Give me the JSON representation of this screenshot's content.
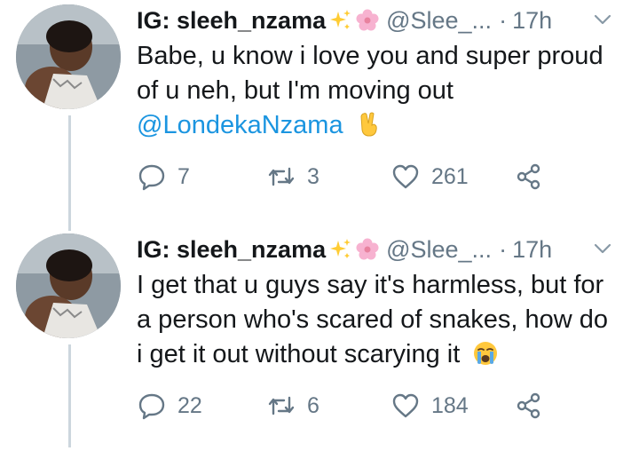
{
  "colors": {
    "text": "#14171a",
    "muted": "#657786",
    "mention": "#1b95e0",
    "thread_line": "#ccd6dd"
  },
  "tweets": [
    {
      "display_name": "IG: sleeh_nzama",
      "name_emojis": [
        "sparkles",
        "cherry-blossom"
      ],
      "handle": "@Slee_...",
      "dot": "·",
      "time": "17h",
      "text_lines": [
        "Babe, u know i love you and super proud",
        "of u neh, but I'm moving out"
      ],
      "mention": "@LondekaNzama",
      "trailing_emoji": "victory-hand",
      "replies": "7",
      "retweets": "3",
      "likes": "261"
    },
    {
      "display_name": "IG: sleeh_nzama",
      "name_emojis": [
        "sparkles",
        "cherry-blossom"
      ],
      "handle": "@Slee_...",
      "dot": "·",
      "time": "17h",
      "text_lines": [
        "I get that u guys say it's harmless, but for",
        "a person who's scared of snakes, how do",
        "i get it out without scarying it"
      ],
      "trailing_emoji": "loudly-crying-face",
      "replies": "22",
      "retweets": "6",
      "likes": "184"
    }
  ]
}
